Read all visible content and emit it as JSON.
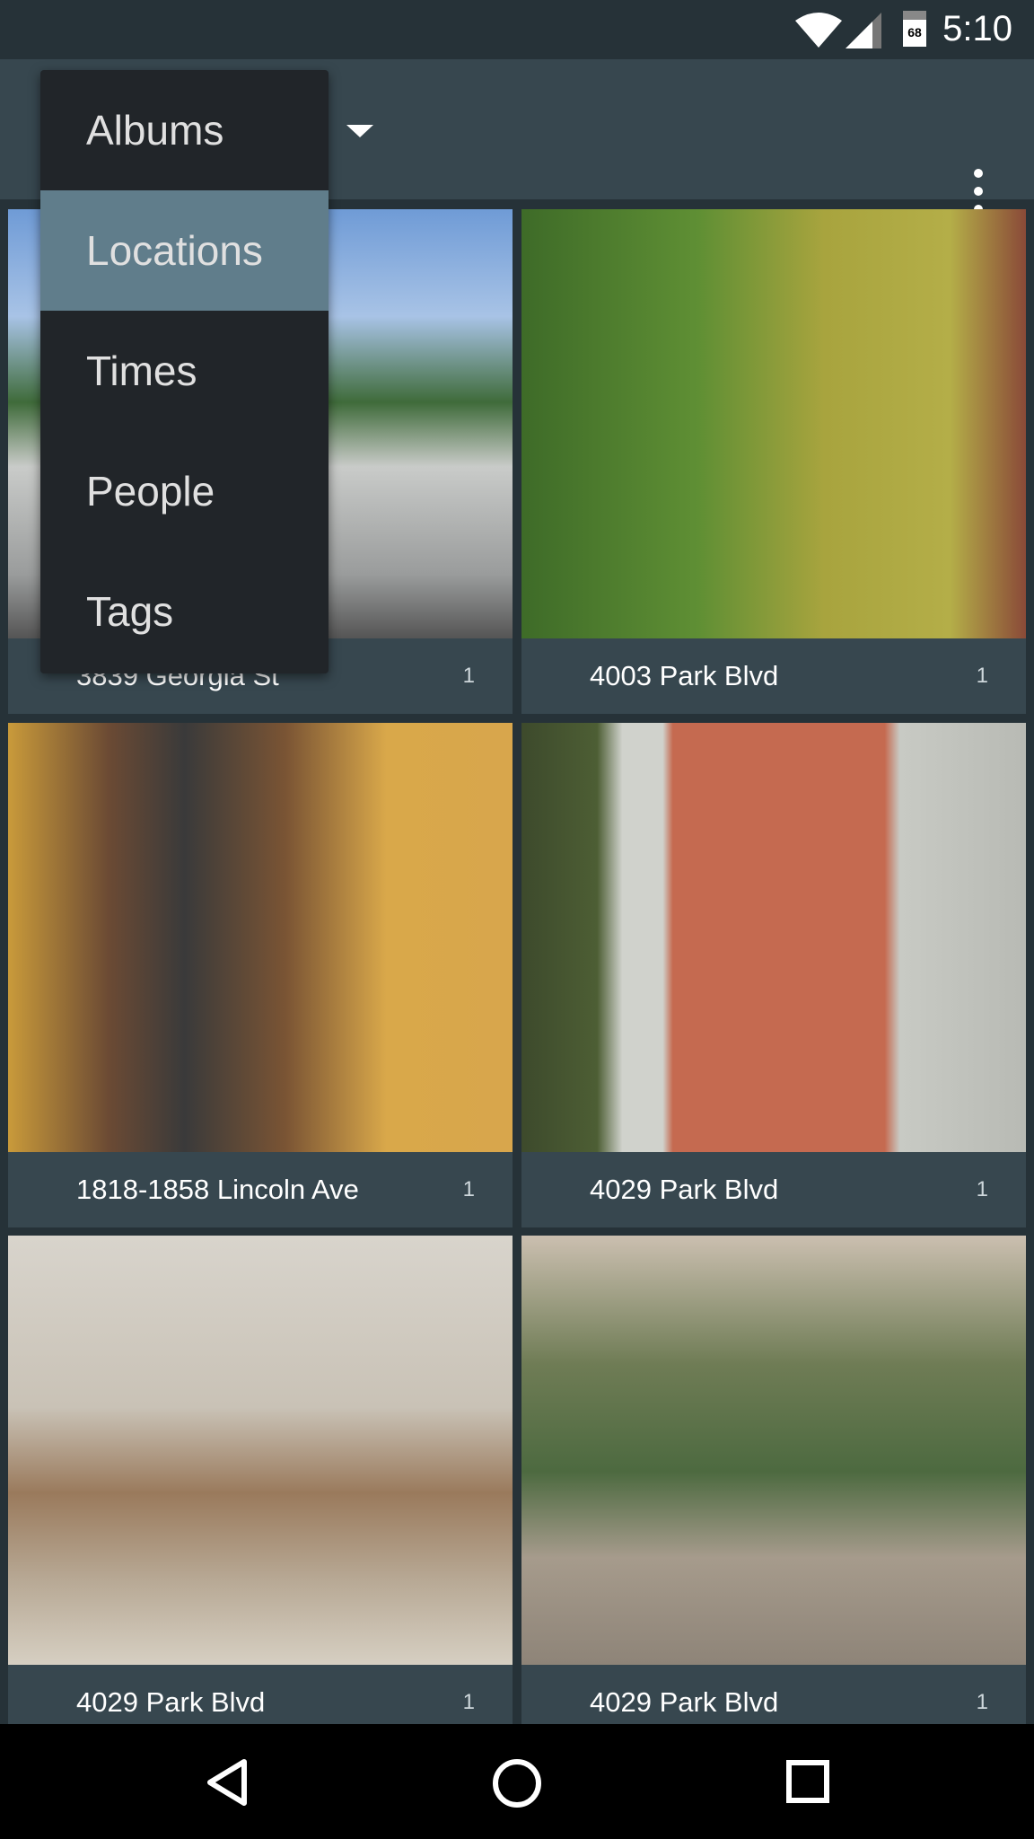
{
  "status_bar": {
    "time": "5:10",
    "battery": "68",
    "icons": [
      "wifi-icon",
      "cell-signal-icon",
      "battery-icon"
    ]
  },
  "toolbar": {
    "icons": [
      "dropdown-caret-icon",
      "overflow-menu-icon"
    ]
  },
  "menu": {
    "items": [
      {
        "label": "Albums",
        "selected": false
      },
      {
        "label": "Locations",
        "selected": true
      },
      {
        "label": "Times",
        "selected": false
      },
      {
        "label": "People",
        "selected": false
      },
      {
        "label": "Tags",
        "selected": false
      }
    ]
  },
  "tiles": [
    {
      "name": "3839 Georgia St",
      "count": "1"
    },
    {
      "name": "4003 Park Blvd",
      "count": "1"
    },
    {
      "name": "1818-1858 Lincoln Ave",
      "count": "1"
    },
    {
      "name": "4029 Park Blvd",
      "count": "1"
    },
    {
      "name": "4029 Park Blvd",
      "count": "1"
    },
    {
      "name": "4029 Park Blvd",
      "count": "1"
    }
  ],
  "nav_bar": {
    "icons": [
      "back-icon",
      "home-icon",
      "recents-icon"
    ]
  },
  "colors": {
    "status_bg": "#263238",
    "toolbar_bg": "#37474f",
    "menu_bg": "#212529",
    "menu_selected": "#607d8b"
  }
}
